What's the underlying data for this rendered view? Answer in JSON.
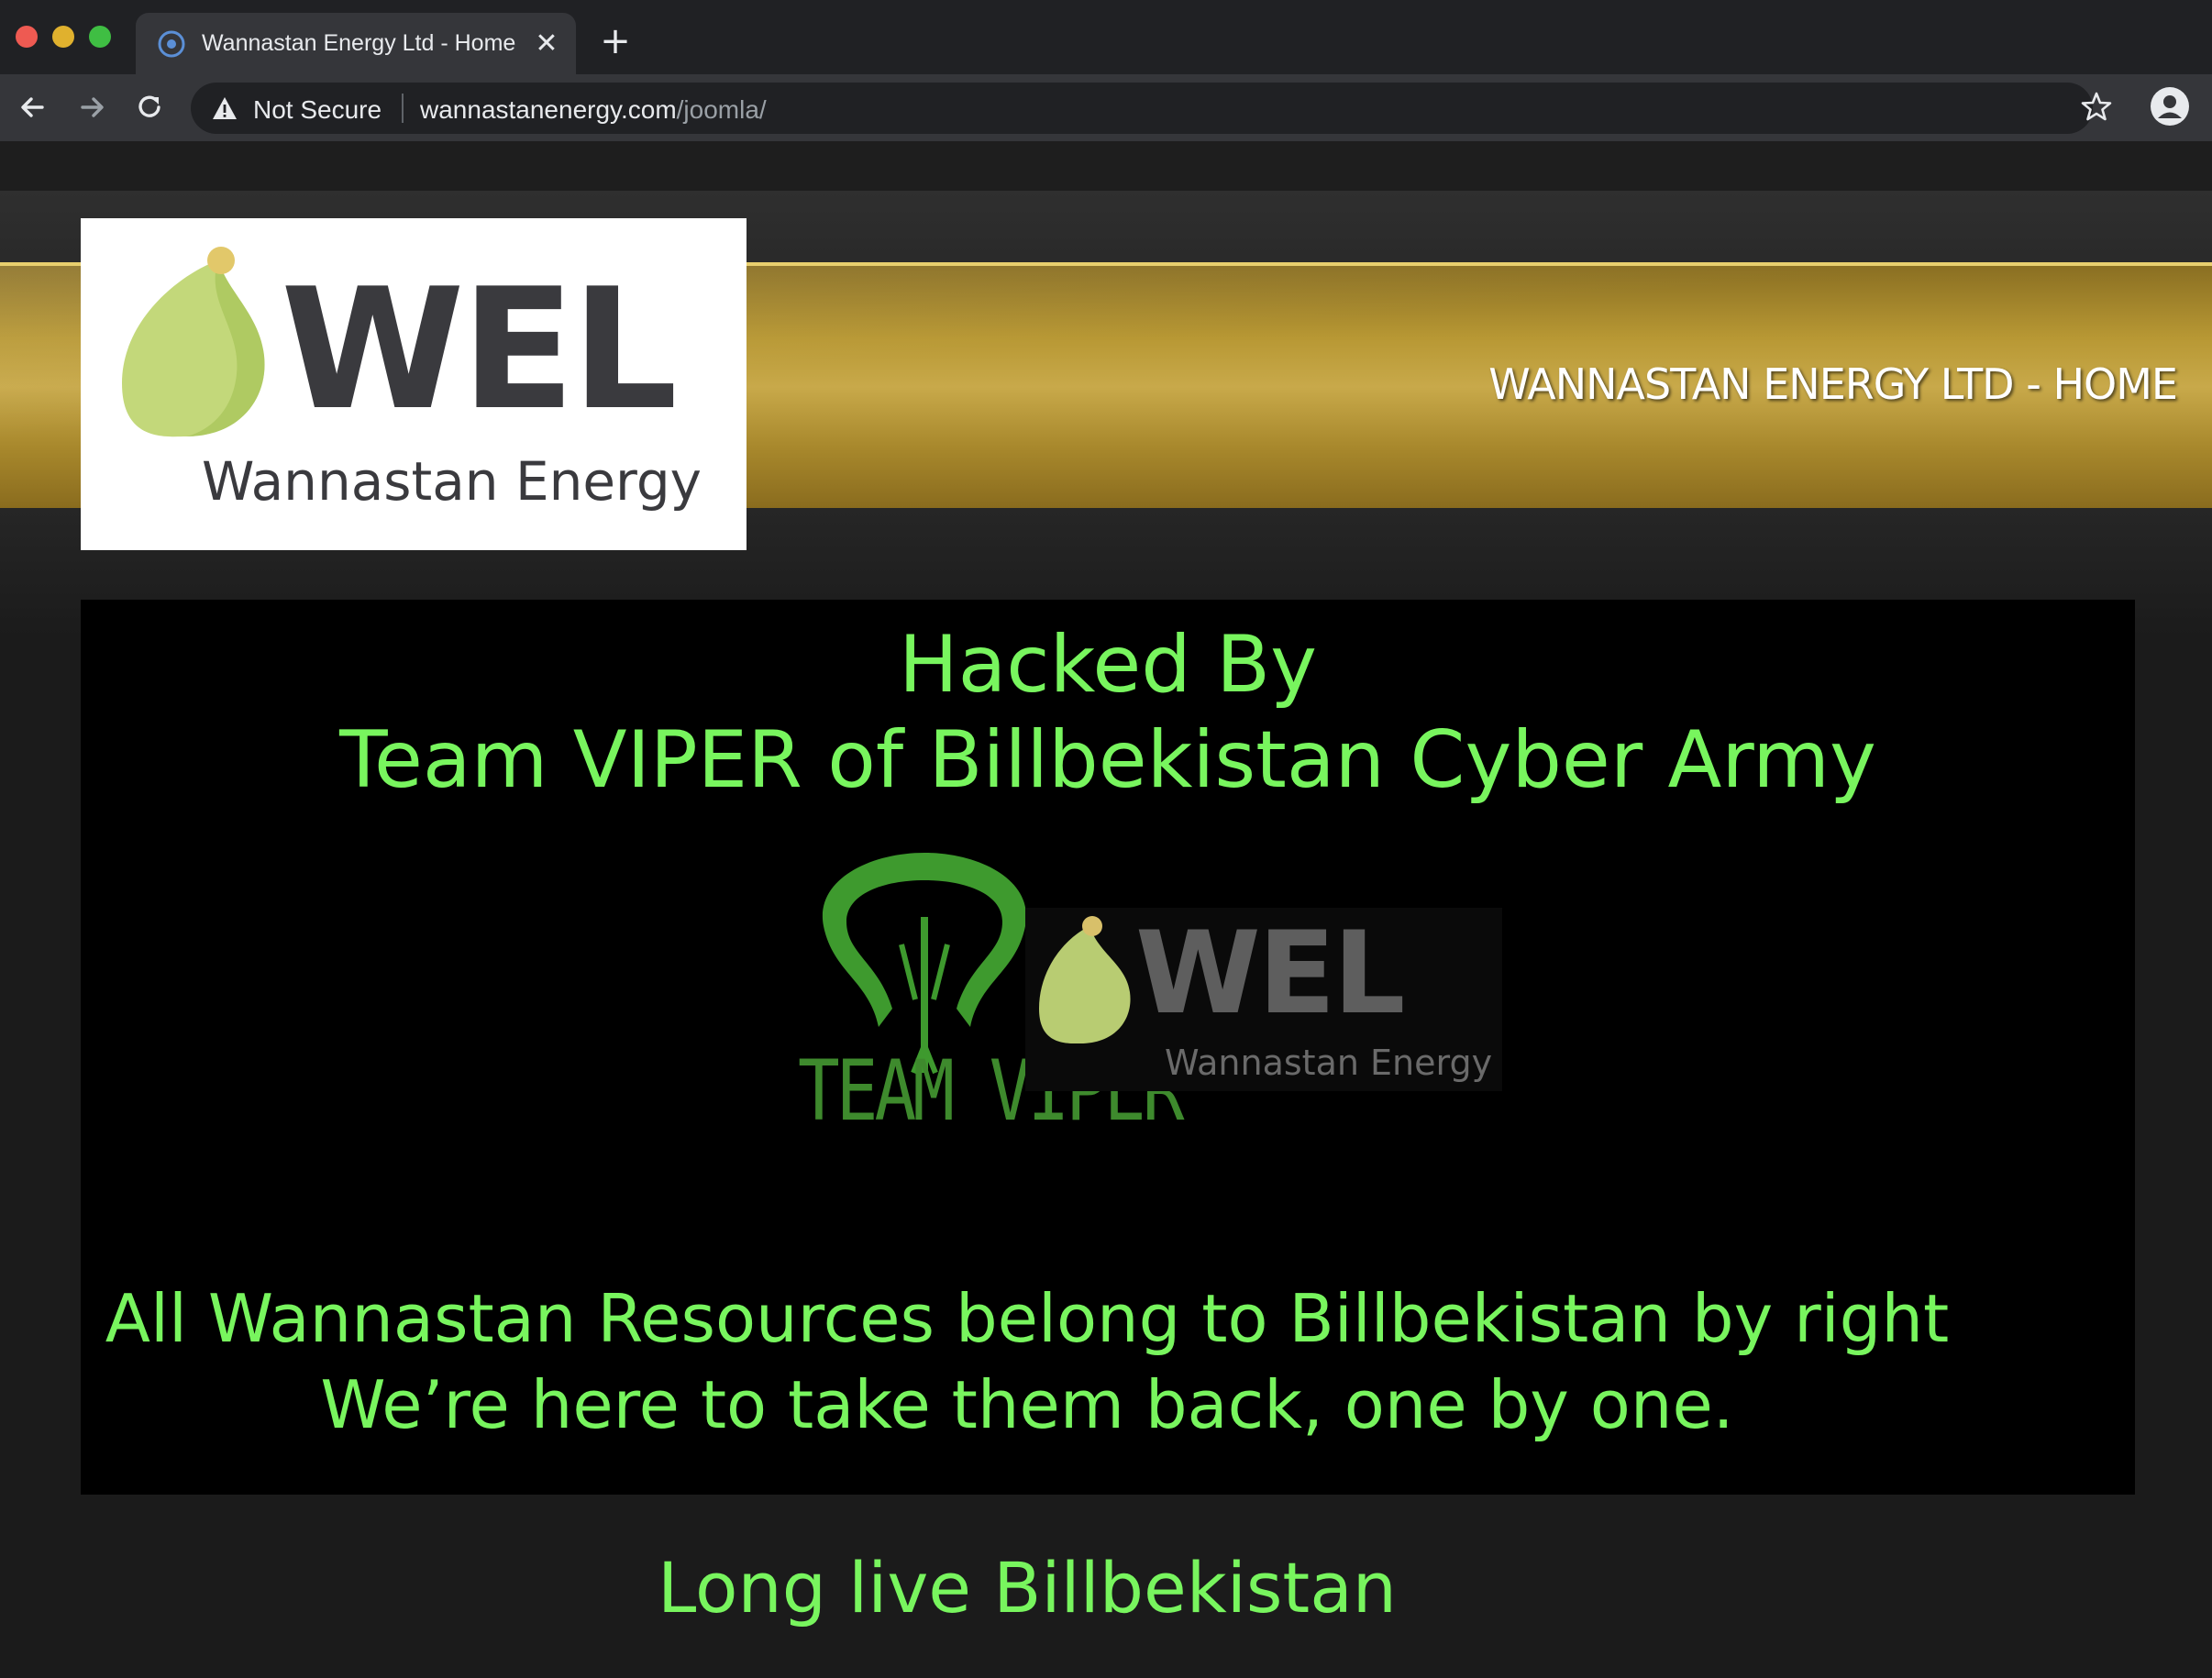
{
  "browser": {
    "tab_title": "Wannastan Energy Ltd - Home",
    "tab_close": "✕",
    "new_tab": "+",
    "security_label": "Not Secure",
    "url_host": "wannastanenergy.com",
    "url_path": "/joomla/"
  },
  "site": {
    "title": "WANNASTAN ENERGY LTD - HOME",
    "logo_text": "WEL",
    "logo_subtitle": "Wannastan Energy"
  },
  "defacement": {
    "line1": "Hacked By",
    "line2": "Team VIPER of Billbekistan Cyber Army",
    "viper_logo_text": "TEAM VIPER",
    "wel_logo_text": "WEL",
    "wel_logo_subtitle": "Wannastan Energy",
    "line3": "All Wannastan Resources belong to Billbekistan by right",
    "line4": "We’re here to take them back, one by one.",
    "line5": "Long live Billbekistan"
  },
  "colors": {
    "hack_green": "#78f55e",
    "logo_leaf": "#c3d87a",
    "gold_band": "#b89834"
  }
}
